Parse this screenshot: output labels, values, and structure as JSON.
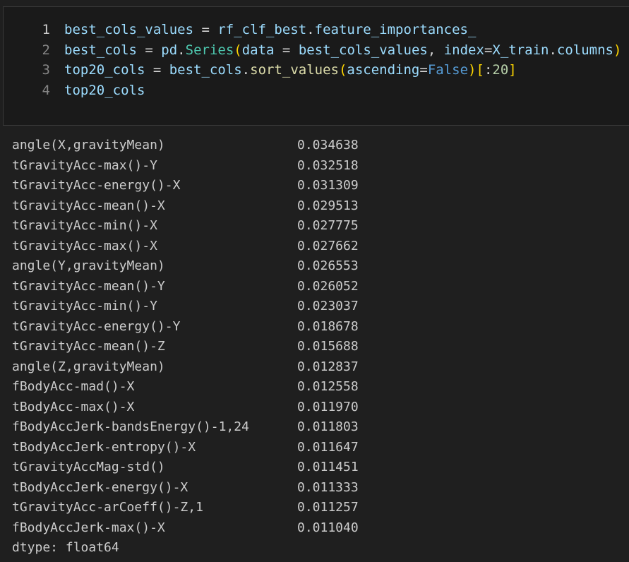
{
  "code_cell": {
    "lines": [
      {
        "number": "1",
        "tokens": [
          {
            "t": "best_cols_values",
            "c": "v"
          },
          {
            "t": " = ",
            "c": "op"
          },
          {
            "t": "rf_clf_best",
            "c": "v"
          },
          {
            "t": ".",
            "c": "op"
          },
          {
            "t": "feature_importances_",
            "c": "v"
          }
        ]
      },
      {
        "number": "2",
        "tokens": [
          {
            "t": "best_cols",
            "c": "v"
          },
          {
            "t": " = ",
            "c": "op"
          },
          {
            "t": "pd",
            "c": "v"
          },
          {
            "t": ".",
            "c": "op"
          },
          {
            "t": "Series",
            "c": "c"
          },
          {
            "t": "(",
            "c": "b1"
          },
          {
            "t": "data",
            "c": "v"
          },
          {
            "t": " = ",
            "c": "op"
          },
          {
            "t": "best_cols_values",
            "c": "v"
          },
          {
            "t": ", ",
            "c": "op"
          },
          {
            "t": "index",
            "c": "v"
          },
          {
            "t": "=",
            "c": "op"
          },
          {
            "t": "X_train",
            "c": "v"
          },
          {
            "t": ".",
            "c": "op"
          },
          {
            "t": "columns",
            "c": "v"
          },
          {
            "t": ")",
            "c": "b1"
          }
        ]
      },
      {
        "number": "3",
        "tokens": [
          {
            "t": "top20_cols",
            "c": "v"
          },
          {
            "t": " = ",
            "c": "op"
          },
          {
            "t": "best_cols",
            "c": "v"
          },
          {
            "t": ".",
            "c": "op"
          },
          {
            "t": "sort_values",
            "c": "f"
          },
          {
            "t": "(",
            "c": "b1"
          },
          {
            "t": "ascending",
            "c": "v"
          },
          {
            "t": "=",
            "c": "op"
          },
          {
            "t": "False",
            "c": "k"
          },
          {
            "t": ")",
            "c": "b1"
          },
          {
            "t": "[",
            "c": "b1"
          },
          {
            "t": ":",
            "c": "op"
          },
          {
            "t": "20",
            "c": "n"
          },
          {
            "t": "]",
            "c": "b1"
          }
        ]
      },
      {
        "number": "4",
        "tokens": [
          {
            "t": "top20_cols",
            "c": "v"
          }
        ]
      }
    ]
  },
  "output": {
    "rows": [
      {
        "name": "angle(X,gravityMean)",
        "value": "0.034638"
      },
      {
        "name": "tGravityAcc-max()-Y",
        "value": "0.032518"
      },
      {
        "name": "tGravityAcc-energy()-X",
        "value": "0.031309"
      },
      {
        "name": "tGravityAcc-mean()-X",
        "value": "0.029513"
      },
      {
        "name": "tGravityAcc-min()-X",
        "value": "0.027775"
      },
      {
        "name": "tGravityAcc-max()-X",
        "value": "0.027662"
      },
      {
        "name": "angle(Y,gravityMean)",
        "value": "0.026553"
      },
      {
        "name": "tGravityAcc-mean()-Y",
        "value": "0.026052"
      },
      {
        "name": "tGravityAcc-min()-Y",
        "value": "0.023037"
      },
      {
        "name": "tGravityAcc-energy()-Y",
        "value": "0.018678"
      },
      {
        "name": "tGravityAcc-mean()-Z",
        "value": "0.015688"
      },
      {
        "name": "angle(Z,gravityMean)",
        "value": "0.012837"
      },
      {
        "name": "fBodyAcc-mad()-X",
        "value": "0.012558"
      },
      {
        "name": "tBodyAcc-max()-X",
        "value": "0.011970"
      },
      {
        "name": "fBodyAccJerk-bandsEnergy()-1,24",
        "value": "0.011803"
      },
      {
        "name": "tBodyAccJerk-entropy()-X",
        "value": "0.011647"
      },
      {
        "name": "tGravityAccMag-std()",
        "value": "0.011451"
      },
      {
        "name": "tBodyAccJerk-energy()-X",
        "value": "0.011333"
      },
      {
        "name": "tGravityAcc-arCoeff()-Z,1",
        "value": "0.011257"
      },
      {
        "name": "fBodyAccJerk-max()-X",
        "value": "0.011040"
      }
    ],
    "dtype": "dtype: float64"
  },
  "colors": {
    "background": "#1f1f1f",
    "cell_background": "#1a1a1a",
    "variable": "#9cdcfe",
    "class": "#4ec9b0",
    "function": "#dcdcaa",
    "keyword": "#569cd6",
    "number": "#b5cea8",
    "bracket": "#ffd700"
  }
}
